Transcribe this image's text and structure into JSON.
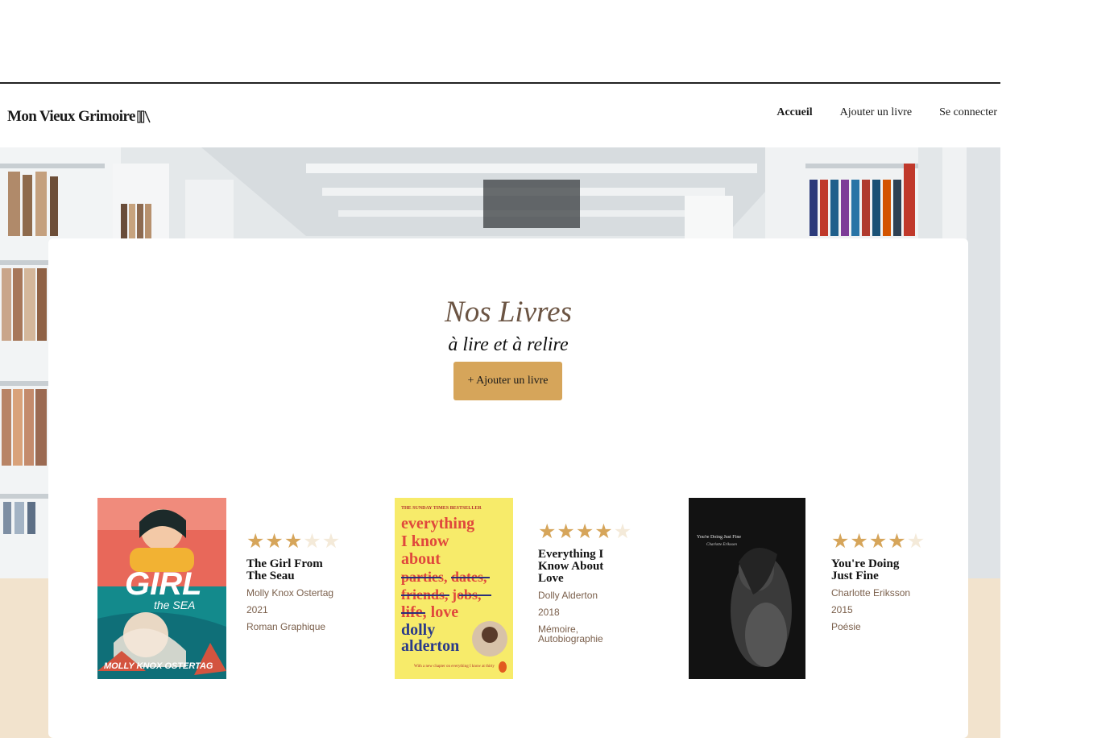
{
  "header": {
    "logo_text": "Mon Vieux Grimoire",
    "nav": [
      {
        "label": "Accueil",
        "active": true
      },
      {
        "label": "Ajouter un livre",
        "active": false
      },
      {
        "label": "Se connecter",
        "active": false
      }
    ]
  },
  "main": {
    "title": "Nos Livres",
    "subtitle": "à lire et à relire",
    "add_button_label": "+ Ajouter un livre"
  },
  "books": [
    {
      "title": "The Girl From The Seau",
      "author": "Molly Knox Ostertag",
      "year": "2021",
      "genre": "Roman Graphique",
      "rating": 3,
      "rating_max": 5,
      "cover_text": {
        "main": "GIRL",
        "sub": "the SEA",
        "author": "MOLLY KNOX OSTERTAG"
      }
    },
    {
      "title": "Everything I Know About Love",
      "author": "Dolly Alderton",
      "year": "2018",
      "genre": "Mémoire, Autobiographie",
      "rating": 4,
      "rating_max": 5,
      "cover_text": {
        "top": "THE SUNDAY TIMES BESTSELLER",
        "main": "everything I know about parties, dates, friends, jobs, life, love",
        "author": "dolly alderton",
        "footer": "With a new chapter on everything I know at thirty"
      }
    },
    {
      "title": "You're Doing Just Fine",
      "author": "Charlotte Eriksson",
      "year": "2015",
      "genre": "Poésie",
      "rating": 4,
      "rating_max": 5,
      "cover_text": {
        "main": "You're Doing Just Fine",
        "author": "Charlotte Eriksson"
      }
    }
  ],
  "colors": {
    "accent": "#d6a55a",
    "beige": "#f2e3cd",
    "title_brown": "#6b5443",
    "meta_brown": "#7a5f4b",
    "star_empty": "#f4ead9"
  }
}
